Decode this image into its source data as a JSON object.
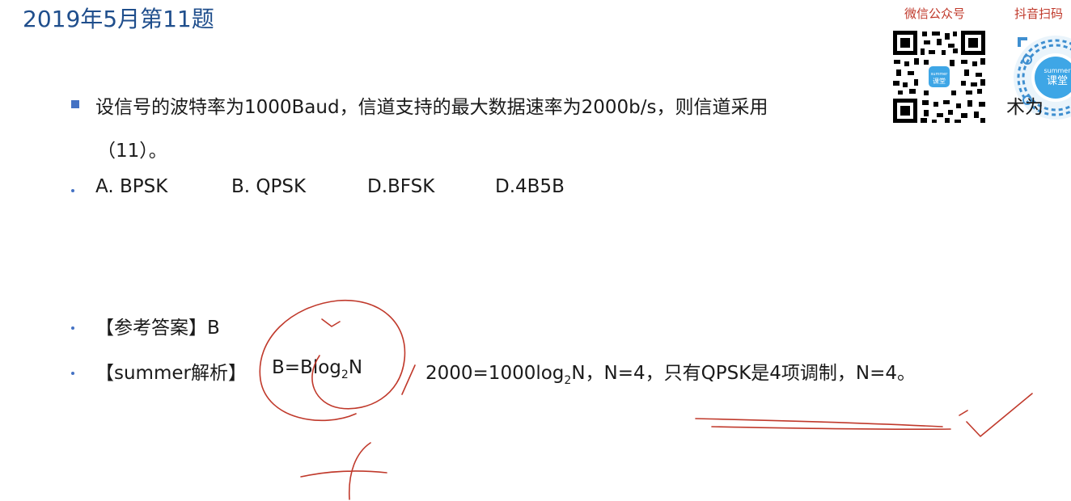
{
  "title": "2019年5月第11题",
  "question": {
    "line1": "设信号的波特率为1000Baud，信道支持的最大数据速率为2000b/s，则信道采用",
    "line1_tail": "术为",
    "line2": "（11）。"
  },
  "options": [
    "A. BPSK",
    "B. QPSK",
    "D.BFSK",
    "D.4B5B"
  ],
  "answer": "【参考答案】B",
  "analysis": {
    "prefix": "【summer解析】",
    "f1_main": "B=Blog",
    "f1_sub": "2",
    "f1_end": "N",
    "f2_main": "2000=1000log",
    "f2_sub": "2",
    "f2_end": "N，N=4，只有QPSK是4项调制，N=4。"
  },
  "qr": {
    "wechat_label": "微信公众号",
    "douyin_label": "抖音扫码",
    "badge_line1": "summer",
    "badge_line2": "课堂"
  },
  "colors": {
    "title": "#1f4e8c",
    "bullet": "#4472c4",
    "ink": "#c0392b",
    "qr_label": "#c0392b"
  }
}
